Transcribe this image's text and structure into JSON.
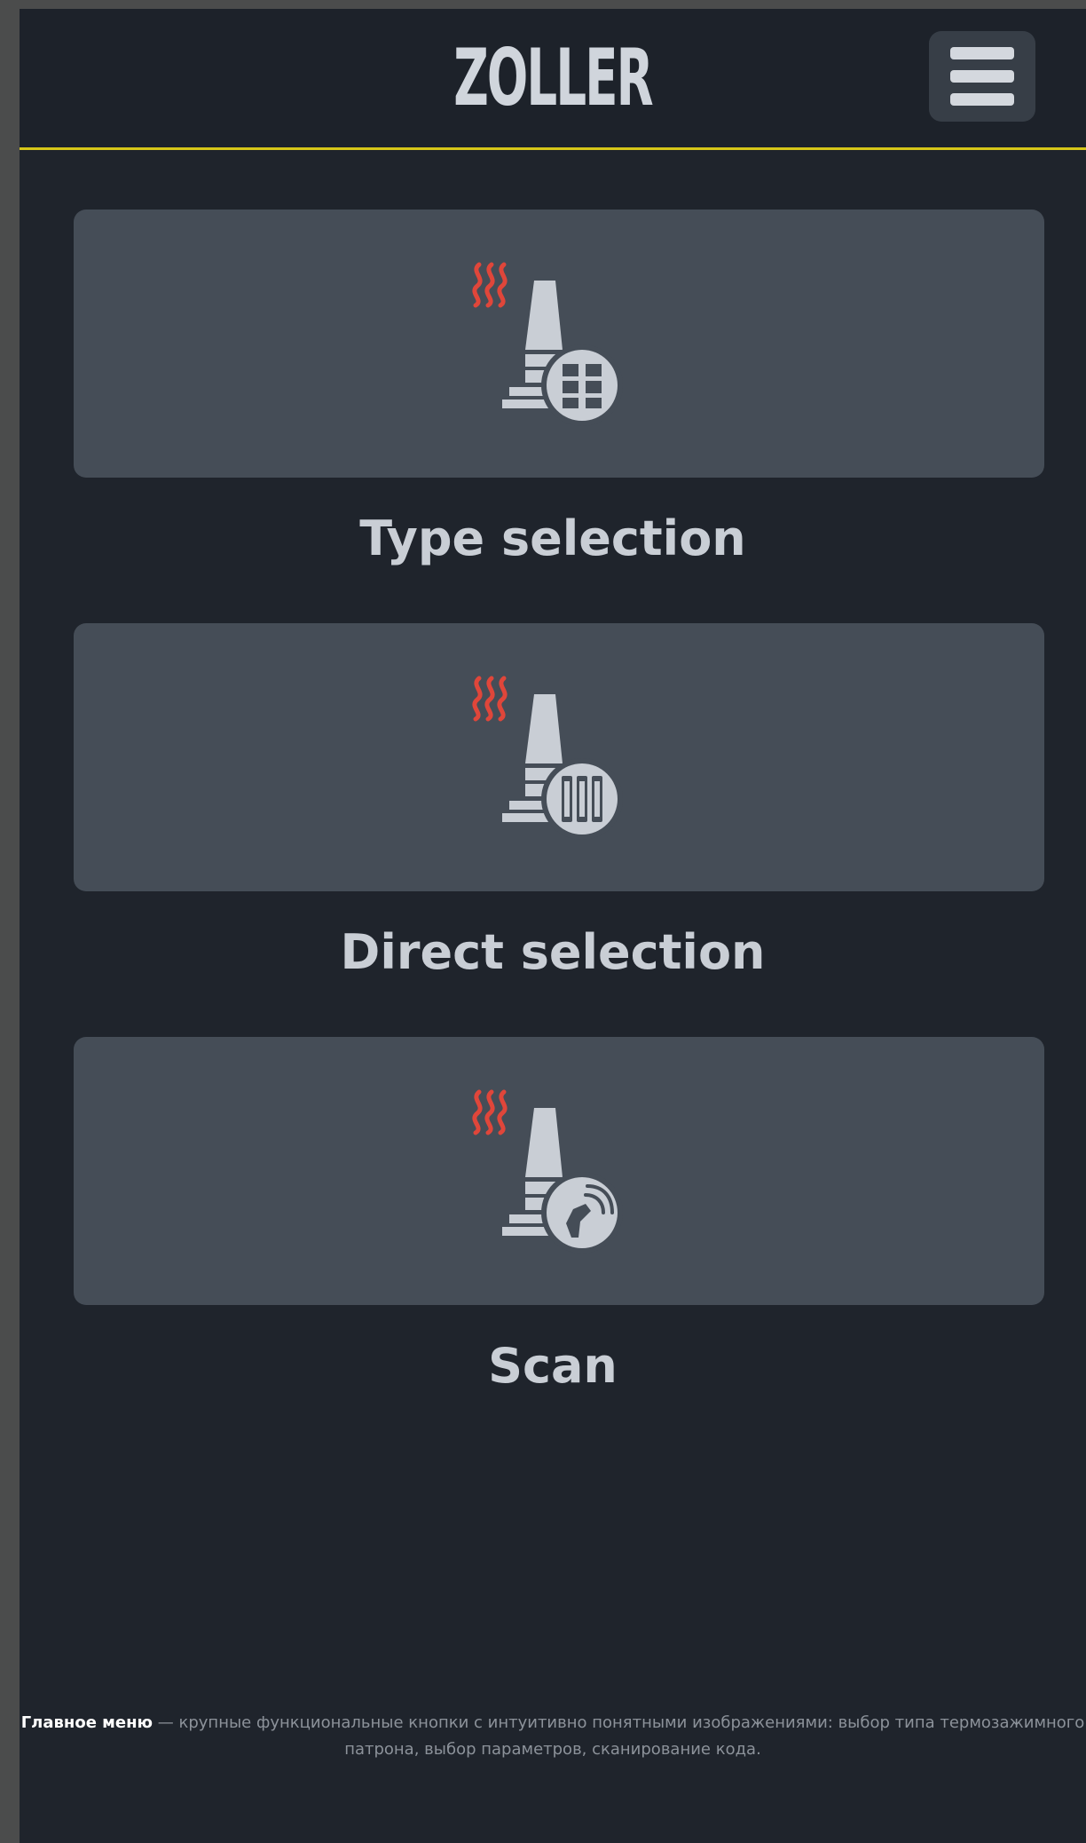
{
  "header": {
    "logo": "ZOLLER",
    "menu_icon": "hamburger-menu-icon"
  },
  "tiles": [
    {
      "label": "Type selection",
      "icon": "heat-shrink-chuck-grid-icon"
    },
    {
      "label": "Direct selection",
      "icon": "heat-shrink-chuck-library-icon"
    },
    {
      "label": "Scan",
      "icon": "heat-shrink-chuck-scan-icon"
    }
  ],
  "caption": {
    "bold": "Главное меню",
    "text": " — крупные функциональные кнопки с интуитивно понятными изображениями: выбор типа термозажимного патрона, выбор параметров, сканирование кода."
  },
  "colors": {
    "accent_line": "#d6c619",
    "heat_waves": "#e0463a",
    "tile_bg": "#454d57",
    "page_bg": "#1f242c"
  }
}
